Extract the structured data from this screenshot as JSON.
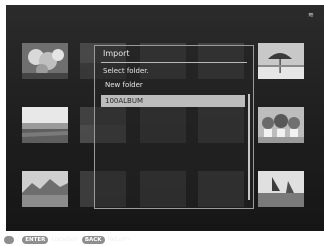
{
  "dialog": {
    "title": "Import",
    "prompt": "Select folder.",
    "folders": [
      {
        "label": "New folder",
        "selected": false
      },
      {
        "label": "100ALBUM",
        "selected": true
      }
    ]
  },
  "footer": {
    "dpad_icon": "dpad-icon",
    "separator": "/",
    "enter_key": "ENTER",
    "enter_action": "Location",
    "back_key": "BACK",
    "back_action": "Return"
  },
  "thumbnails": [
    {
      "name": "thumb-flowers",
      "dim": false
    },
    {
      "name": "thumb-dim-1",
      "dim": true
    },
    {
      "name": "thumb-dim-2",
      "dim": true
    },
    {
      "name": "thumb-dim-3",
      "dim": true
    },
    {
      "name": "thumb-beach-umbrella",
      "dim": false
    },
    {
      "name": "thumb-seascape",
      "dim": false
    },
    {
      "name": "thumb-dim-4",
      "dim": true
    },
    {
      "name": "thumb-dim-5",
      "dim": true
    },
    {
      "name": "thumb-dim-6",
      "dim": true
    },
    {
      "name": "thumb-potted-plants",
      "dim": false
    },
    {
      "name": "thumb-mountain-lake",
      "dim": false
    },
    {
      "name": "thumb-dim-7",
      "dim": true
    },
    {
      "name": "thumb-dim-8",
      "dim": true
    },
    {
      "name": "thumb-dim-9",
      "dim": true
    },
    {
      "name": "thumb-sailboat",
      "dim": false
    }
  ],
  "colors": {
    "screen_bg": "#242424",
    "dialog_border": "#9a9a9a",
    "selection_bg": "#bdbdbd",
    "key_pill": "#8e8e8e"
  }
}
